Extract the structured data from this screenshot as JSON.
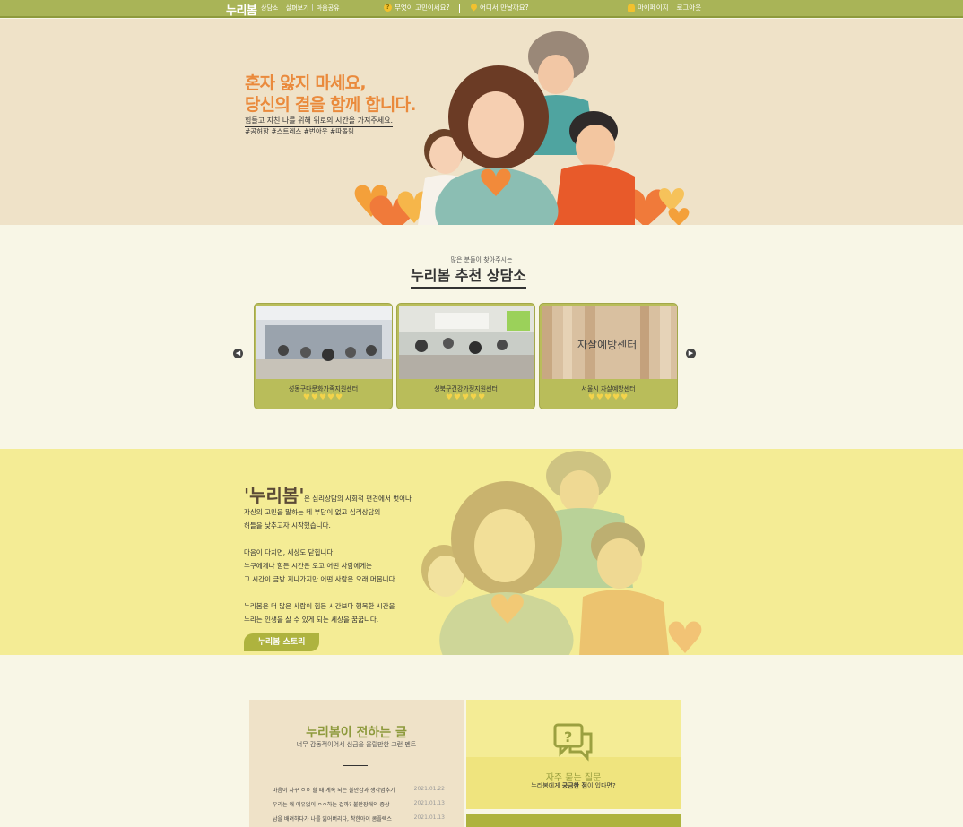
{
  "nav": {
    "logo": "누리봄",
    "links": [
      "상담소",
      "살펴보기",
      "마음공유"
    ],
    "question1": "무엇이 고민이세요?",
    "question2": "어디서 만날까요?",
    "mypage": "마이페이지",
    "logout": "로그아웃"
  },
  "hero": {
    "headline_line1": "혼자 앓지 마세요,",
    "headline_line2": "당신의 곁을 함께 합니다.",
    "subtitle": "힘들고 지친 나를 위해 위로의 시간을 가져주세요.",
    "tags": "#공허함 #스트레스 #번아웃 #따돌림"
  },
  "recommend": {
    "small": "많은 분들이 찾아주시는",
    "title": "누리봄 추천 상담소",
    "cards": [
      {
        "name": "성동구다문화가족지원센터",
        "rating": 5,
        "hearts": "♥♥♥♥♥"
      },
      {
        "name": "성북구건강가정지원센터",
        "rating": 5,
        "hearts": "♥♥♥♥♥"
      },
      {
        "name": "서울시 자살예방센터",
        "rating": 5,
        "hearts": "♥♥♥♥♥",
        "sign_text": "자살예방센터"
      }
    ]
  },
  "story": {
    "brand": "'누리봄'",
    "lines": [
      "은 심리상담의 사회적 편견에서 벗어나",
      "자신의 고민을 말하는 데 부담이 없고 심리상담의",
      "허들을 낮추고자 시작했습니다.",
      "",
      "마음이 다치면, 세상도 닫힙니다.",
      "누구에게나 힘든 시간은 오고 어떤 사람에게는",
      "그 시간이 금방 지나가지만 어떤 사람은 오래 머뭅니다.",
      "",
      "누리봄은 더 많은 사람이 힘든 시간보다 행복한 시간을",
      "누리는 인생을 살 수 있게 되는 세상을 꿈꿉니다."
    ],
    "button": "누리봄 스토리"
  },
  "posts": {
    "title": "누리봄이 전하는 글",
    "subtitle": "너무 감동적이어서 심금을 울릴만한 그런 멘트",
    "items": [
      {
        "title": "마음이 자꾸 ㅇㅇ 할 때 계속 되는 불안감과 생각멈추기",
        "date": "2021.01.22"
      },
      {
        "title": "우리는 왜 이유없이 ㅇㅇ하는 걸까? 불안장애의 증상",
        "date": "2021.01.13"
      },
      {
        "title": "남을 배려하다가 나를 잃어버리다, 착한아이 콤플렉스",
        "date": "2021.01.13"
      }
    ]
  },
  "faq": {
    "title": "자주 묻는 질문",
    "sub_prefix": "누리봄에게 ",
    "sub_bold": "궁금한 점",
    "sub_suffix": "이 있다면?"
  },
  "colors": {
    "nav": "#a9b457",
    "hero_bg": "#efe2c8",
    "headline": "#ea8a3c",
    "story_bg": "#f4ec95",
    "card": "#b9bd5a",
    "heart": "#f3d34a"
  }
}
